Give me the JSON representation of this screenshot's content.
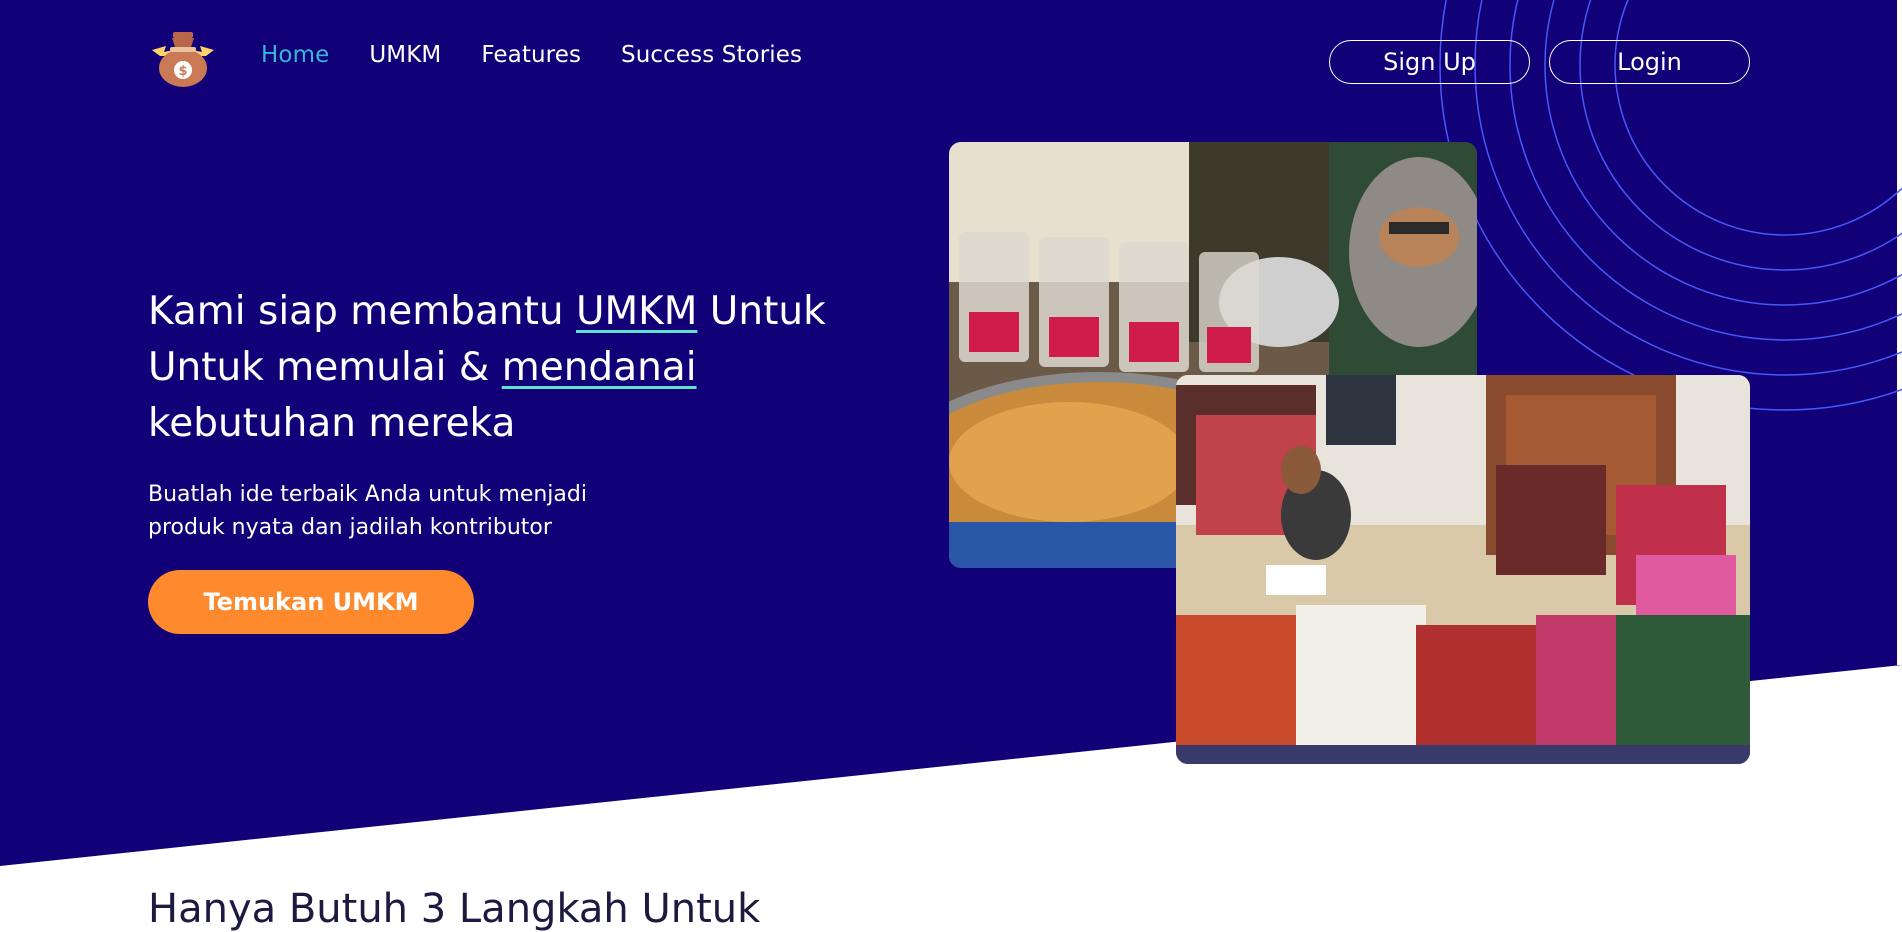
{
  "brand": {
    "logo_icon": "money-bag-icon",
    "logo_symbol": "$"
  },
  "nav": {
    "items": [
      {
        "label": "Home",
        "active": true
      },
      {
        "label": "UMKM",
        "active": false
      },
      {
        "label": "Features",
        "active": false
      },
      {
        "label": "Success Stories",
        "active": false
      }
    ]
  },
  "auth": {
    "signup_label": "Sign Up",
    "login_label": "Login"
  },
  "hero": {
    "headline_part1": "Kami siap membantu ",
    "headline_link1": "UMKM",
    "headline_part2": " Untuk Untuk memulai & ",
    "headline_link2": "mendanai",
    "headline_part3": " kebutuhan mereka",
    "subtext": "Buatlah ide terbaik Anda untuk menjadi produk nyata dan jadilah kontributor",
    "cta_label": "Temukan UMKM"
  },
  "colors": {
    "hero_bg": "#120078",
    "accent": "#ff8a2e",
    "active_nav": "#38b6d8",
    "underline": "#5fe3d0",
    "circle_lines": "#4a5cff"
  },
  "next_section": {
    "title": "Hanya Butuh 3 Langkah Untuk"
  }
}
